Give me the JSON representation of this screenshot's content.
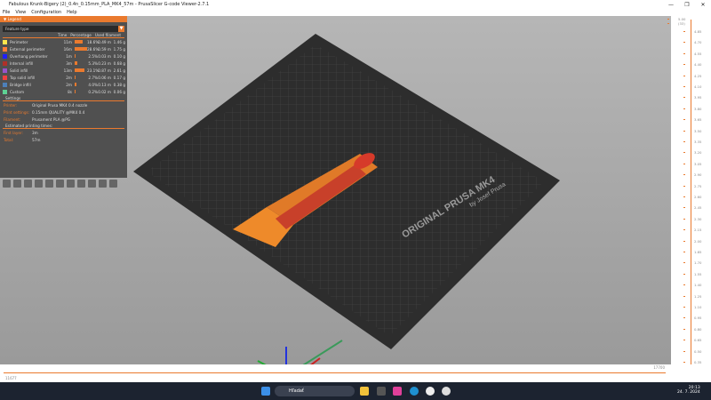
{
  "window": {
    "title": "Fabulous Krunk-Bigery (2)_0.4n_0.15mm_PLA_MK4_57m - PrusaSlicer G-code Viewer-2.7.1",
    "controls": [
      "—",
      "❐",
      "✕"
    ]
  },
  "menu": [
    "File",
    "View",
    "Configuration",
    "Help"
  ],
  "legend": {
    "title": "Legend",
    "view_type": "Feature type",
    "columns": [
      "Time",
      "Percentage",
      "Used filament"
    ],
    "items": [
      {
        "name": "Perimeter",
        "color": "#ffe64d",
        "time": "11m",
        "pct": 18.6,
        "pct_label": "18.6%",
        "length": "0.49 m",
        "weight": "1.46 g"
      },
      {
        "name": "External perimeter",
        "color": "#ff7d38",
        "time": "16m",
        "pct": 28.6,
        "pct_label": "28.6%",
        "length": "0.59 m",
        "weight": "1.75 g"
      },
      {
        "name": "Overhang perimeter",
        "color": "#1f1fff",
        "time": "1m",
        "pct": 2.5,
        "pct_label": "2.5%",
        "length": "0.03 m",
        "weight": "0.10 g"
      },
      {
        "name": "Internal infill",
        "color": "#b03029",
        "time": "3m",
        "pct": 5.3,
        "pct_label": "5.3%",
        "length": "0.23 m",
        "weight": "0.68 g"
      },
      {
        "name": "Solid infill",
        "color": "#9654cc",
        "time": "13m",
        "pct": 23.1,
        "pct_label": "23.1%",
        "length": "0.87 m",
        "weight": "2.61 g"
      },
      {
        "name": "Top solid infill",
        "color": "#f04040",
        "time": "2m",
        "pct": 2.7,
        "pct_label": "2.7%",
        "length": "0.06 m",
        "weight": "0.17 g"
      },
      {
        "name": "Bridge infill",
        "color": "#4d80ba",
        "time": "2m",
        "pct": 4.0,
        "pct_label": "4.0%",
        "length": "0.13 m",
        "weight": "0.38 g"
      },
      {
        "name": "Custom",
        "color": "#5ed194",
        "time": "8s",
        "pct": 0.2,
        "pct_label": "0.2%",
        "length": "0.02 m",
        "weight": "0.06 g"
      }
    ],
    "settings_title": "Settings",
    "settings": [
      {
        "k": "Printer:",
        "v": "Original Prusa MK4 0.4 nozzle"
      },
      {
        "k": "Print settings:",
        "v": "0.15mm QUALITY @MK4 0.4"
      },
      {
        "k": "Filament:",
        "v": "Prusament PLA @PG"
      }
    ],
    "times_title": "Estimated printing times:",
    "times": [
      {
        "k": "First layer:",
        "v": "3m"
      },
      {
        "k": "Total:",
        "v": "57m"
      }
    ]
  },
  "bed": {
    "brand": "ORIGINAL PRUSA MK4",
    "sub": "by Josef Prusa"
  },
  "vslider": {
    "top": "5.00",
    "top_layer": "(33)",
    "bottom": "0.20",
    "bottom_layer": "(1)",
    "ticks": [
      "4.85",
      "4.70",
      "4.55",
      "4.40",
      "4.25",
      "4.10",
      "3.95",
      "3.80",
      "3.65",
      "3.50",
      "3.35",
      "3.20",
      "3.05",
      "2.90",
      "2.75",
      "2.60",
      "2.45",
      "2.30",
      "2.15",
      "2.00",
      "1.85",
      "1.70",
      "1.55",
      "1.40",
      "1.25",
      "1.10",
      "0.95",
      "0.80",
      "0.65",
      "0.50",
      "0.35"
    ]
  },
  "hslider": {
    "left": "11677",
    "right": "17700"
  },
  "taskbar": {
    "search": "Hľadať",
    "time": "20:13",
    "date": "24. 7. 2024"
  },
  "accent": "#ea7a2e"
}
